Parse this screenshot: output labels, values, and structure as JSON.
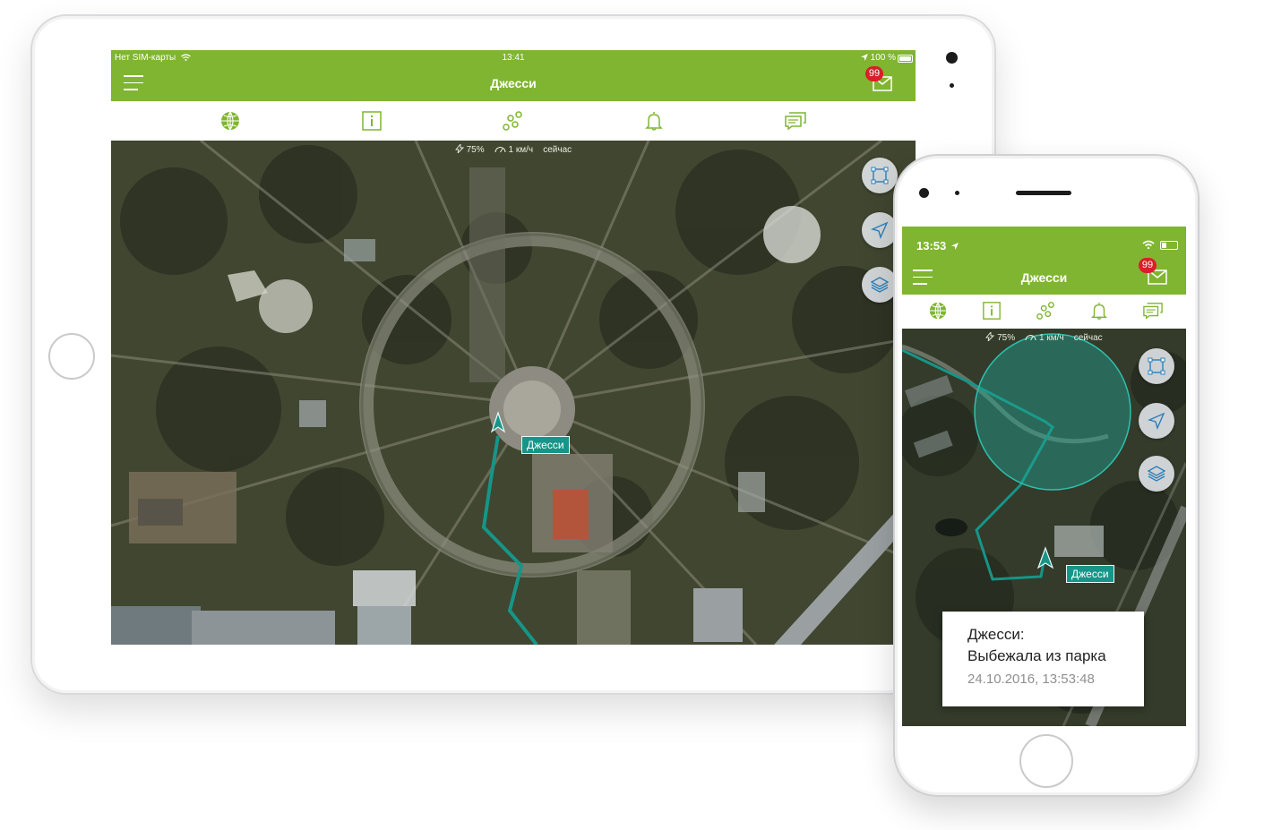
{
  "tablet": {
    "status": {
      "carrier": "Нет SIM-карты",
      "time": "13:41",
      "battery": "100 %"
    },
    "title": "Джесси",
    "badge": "99",
    "info": {
      "battery": "75%",
      "speed": "1 км/ч",
      "updated": "сейчас"
    },
    "marker_label": "Джесси",
    "tabs": [
      "globe-icon",
      "info-icon",
      "route-icon",
      "bell-icon",
      "chat-icon"
    ],
    "map_buttons": [
      "geofence-icon",
      "locate-icon",
      "layers-icon"
    ]
  },
  "phone": {
    "status": {
      "time": "13:53"
    },
    "title": "Джесси",
    "badge": "99",
    "info": {
      "battery": "75%",
      "speed": "1 км/ч",
      "updated": "сейчас"
    },
    "marker_label": "Джесси",
    "notification": {
      "title": "Джесси:",
      "message": "Выбежала из парка",
      "timestamp": "24.10.2016, 13:53:48"
    }
  },
  "colors": {
    "brand_green": "#7fb530",
    "track_teal": "#169588",
    "badge_red": "#d81f2a"
  }
}
